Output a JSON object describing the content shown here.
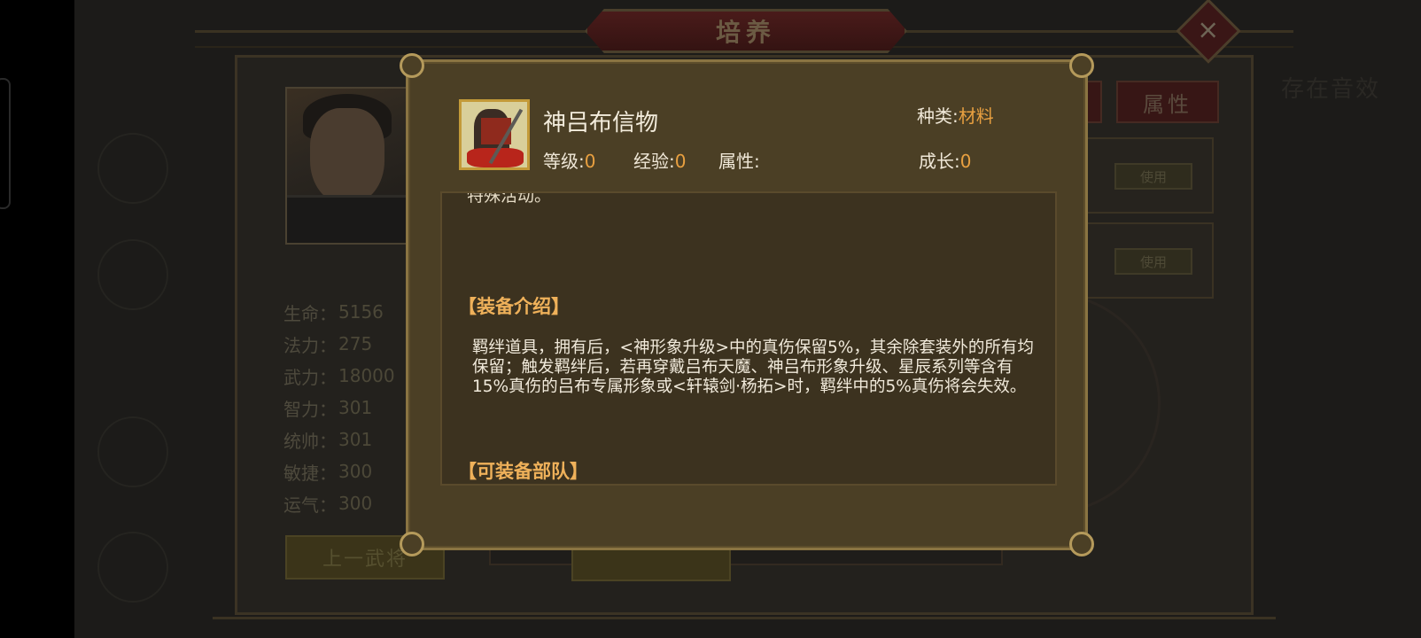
{
  "background": {
    "title": "培养",
    "close_icon": "×",
    "stats": [
      {
        "label": "生命：",
        "value": "5156"
      },
      {
        "label": "法力：",
        "value": "275"
      },
      {
        "label": "武力：",
        "value": "18000"
      },
      {
        "label": "智力：",
        "value": "301"
      },
      {
        "label": "统帅：",
        "value": "301"
      },
      {
        "label": "敏捷：",
        "value": "300"
      },
      {
        "label": "运气：",
        "value": "300"
      }
    ],
    "prev_button": "上一武将",
    "attr_tab": "属性",
    "use_button_1": "使用",
    "use_button_2": "使用",
    "top_right_text": "存在音效"
  },
  "modal": {
    "item_name": "神吕布信物",
    "category_label": "种类:",
    "category_value": "材料",
    "level_label": "等级:",
    "level_value": "0",
    "exp_label": "经验:",
    "exp_value": "0",
    "attr_label": "属性:",
    "growth_label": "成长:",
    "growth_value": "0",
    "cut_text": "特殊活动。",
    "section1_title": "【装备介绍】",
    "section1_text": "羁绊道具，拥有后，<神形象升级>中的真伤保留5%，其余除套装外的所有均保留；触发羁绊后，若再穿戴吕布天魔、神吕布形象升级、星辰系列等含有15%真伤的吕布专属形象或<轩辕剑·杨拓>时，羁绊中的5%真伤将会失效。",
    "section2_title": "【可装备部队】"
  },
  "colors": {
    "modal_bg": "#4b3f25",
    "modal_border": "#8a7442",
    "value_orange": "#e9a040",
    "section_title": "#efb15a"
  }
}
